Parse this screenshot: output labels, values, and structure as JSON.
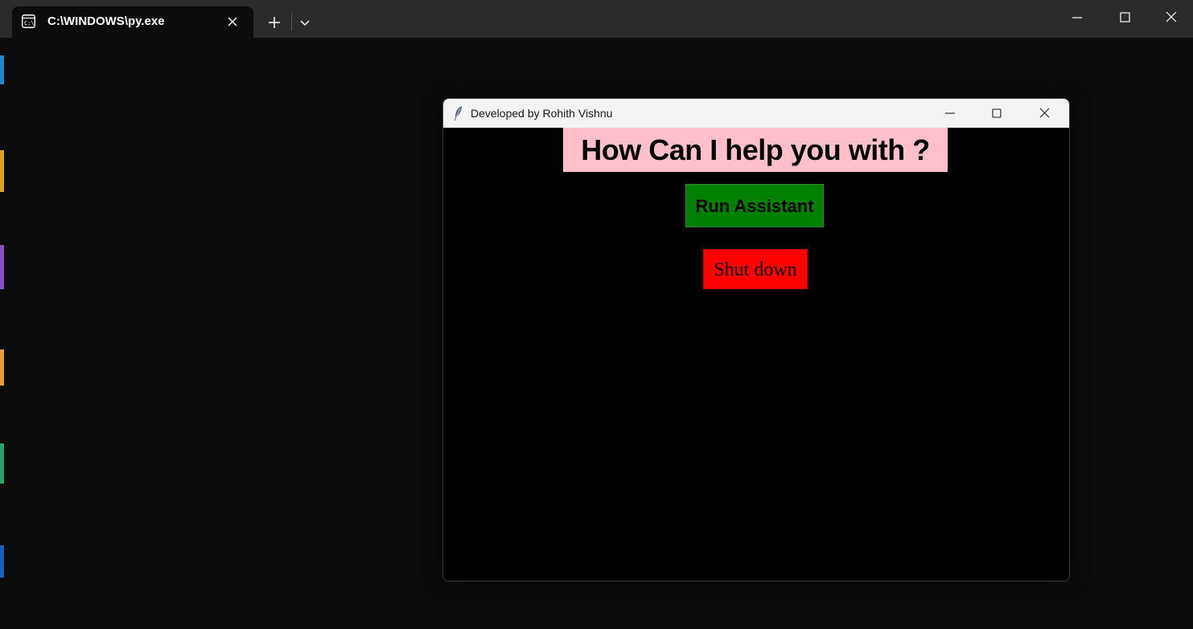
{
  "terminal": {
    "tab_title": "C:\\WINDOWS\\py.exe",
    "icons": {
      "tab": "terminal-icon",
      "close_tab": "close-icon",
      "new_tab": "plus-icon",
      "dropdown": "chevron-down-icon",
      "minimize": "minimize-icon",
      "maximize": "maximize-icon",
      "close": "close-icon"
    },
    "colors": {
      "background": "#0c0c0c",
      "tabbar": "#2b2b2b"
    }
  },
  "app_window": {
    "title": "Developed by Rohith Vishnu",
    "icons": {
      "app": "feather-icon",
      "minimize": "minimize-icon",
      "maximize": "maximize-icon",
      "close": "close-icon"
    },
    "heading": "How Can I help you with ?",
    "run_button_label": "Run Assistant",
    "shutdown_button_label": "Shut down",
    "colors": {
      "background": "#000000",
      "heading_bg": "#ffc0cb",
      "run_button_bg": "#008000",
      "shutdown_button_bg": "#ff0000"
    }
  }
}
